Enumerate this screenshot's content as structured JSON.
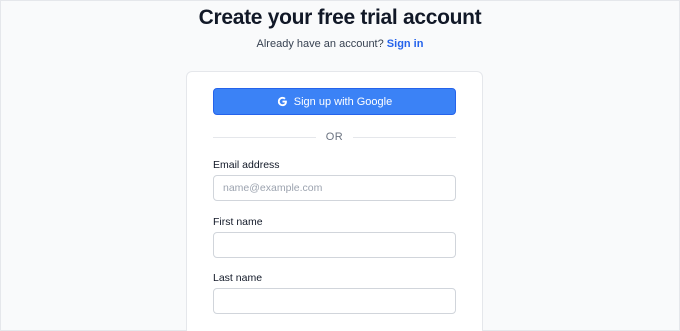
{
  "header": {
    "title": "Create your free trial account",
    "subtitle_text": "Already have an account?",
    "signin_link": "Sign in"
  },
  "form": {
    "google_button_label": "Sign up with Google",
    "divider_text": "OR",
    "fields": [
      {
        "label": "Email address",
        "placeholder": "name@example.com",
        "value": ""
      },
      {
        "label": "First name",
        "placeholder": "",
        "value": ""
      },
      {
        "label": "Last name",
        "placeholder": "",
        "value": ""
      }
    ]
  },
  "colors": {
    "accent": "#3b82f6",
    "link": "#2563eb"
  },
  "icons": {
    "google": "google-g-icon"
  }
}
